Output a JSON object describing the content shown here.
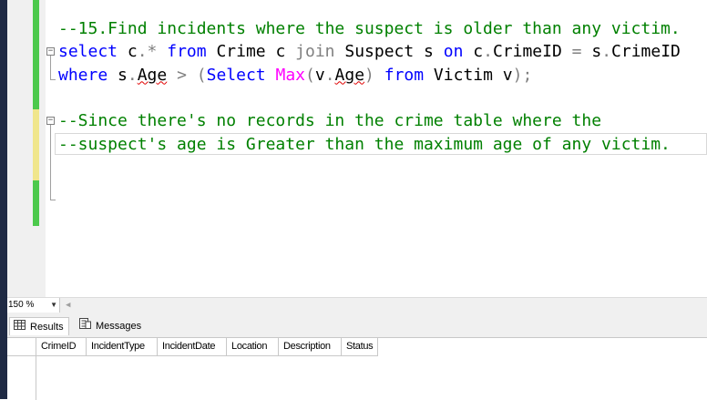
{
  "editor": {
    "lines": [
      [
        {
          "t": "--15.Find incidents where the suspect is older than any victim.",
          "c": "cm"
        }
      ],
      [
        {
          "t": "select",
          "c": "kw"
        },
        {
          "t": " c",
          "c": ""
        },
        {
          "t": ".*",
          "c": "op"
        },
        {
          "t": " ",
          "c": ""
        },
        {
          "t": "from",
          "c": "kw"
        },
        {
          "t": " Crime c ",
          "c": ""
        },
        {
          "t": "join",
          "c": "op"
        },
        {
          "t": " Suspect s ",
          "c": ""
        },
        {
          "t": "on",
          "c": "kw"
        },
        {
          "t": " c",
          "c": ""
        },
        {
          "t": ".",
          "c": "op"
        },
        {
          "t": "CrimeID ",
          "c": ""
        },
        {
          "t": "=",
          "c": "op"
        },
        {
          "t": " s",
          "c": ""
        },
        {
          "t": ".",
          "c": "op"
        },
        {
          "t": "CrimeID",
          "c": ""
        }
      ],
      [
        {
          "t": "where",
          "c": "kw"
        },
        {
          "t": " s",
          "c": ""
        },
        {
          "t": ".",
          "c": "op"
        },
        {
          "t": "Age",
          "c": "sq"
        },
        {
          "t": " ",
          "c": ""
        },
        {
          "t": ">",
          "c": "op"
        },
        {
          "t": " ",
          "c": ""
        },
        {
          "t": "(",
          "c": "op"
        },
        {
          "t": "Select",
          "c": "kw"
        },
        {
          "t": " ",
          "c": ""
        },
        {
          "t": "Max",
          "c": "fn"
        },
        {
          "t": "(",
          "c": "op"
        },
        {
          "t": "v",
          "c": ""
        },
        {
          "t": ".",
          "c": "op"
        },
        {
          "t": "Age",
          "c": "sq"
        },
        {
          "t": ")",
          "c": "op"
        },
        {
          "t": " ",
          "c": ""
        },
        {
          "t": "from",
          "c": "kw"
        },
        {
          "t": " Victim v",
          "c": ""
        },
        {
          "t": ");",
          "c": "op"
        }
      ],
      [],
      [
        {
          "t": "--Since there's no records in the crime table where the",
          "c": "cm"
        }
      ],
      [
        {
          "t": "--suspect's age is Greater than the maximum age of any victim.",
          "c": "cm"
        }
      ],
      [],
      [],
      []
    ]
  },
  "statusbar": {
    "zoom": "150 %"
  },
  "tabs": [
    {
      "label": "Results",
      "icon": "grid-icon"
    },
    {
      "label": "Messages",
      "icon": "messages-icon"
    }
  ],
  "grid": {
    "columns": [
      "CrimeID",
      "IncidentType",
      "IncidentDate",
      "Location",
      "Description",
      "Status"
    ]
  },
  "colors": {
    "comment": "#008000",
    "keyword": "#0000ff",
    "function": "#ff00ff",
    "operator": "#808080",
    "changed_saved": "#4cc94c",
    "changed_unsaved": "#f0e68c"
  }
}
